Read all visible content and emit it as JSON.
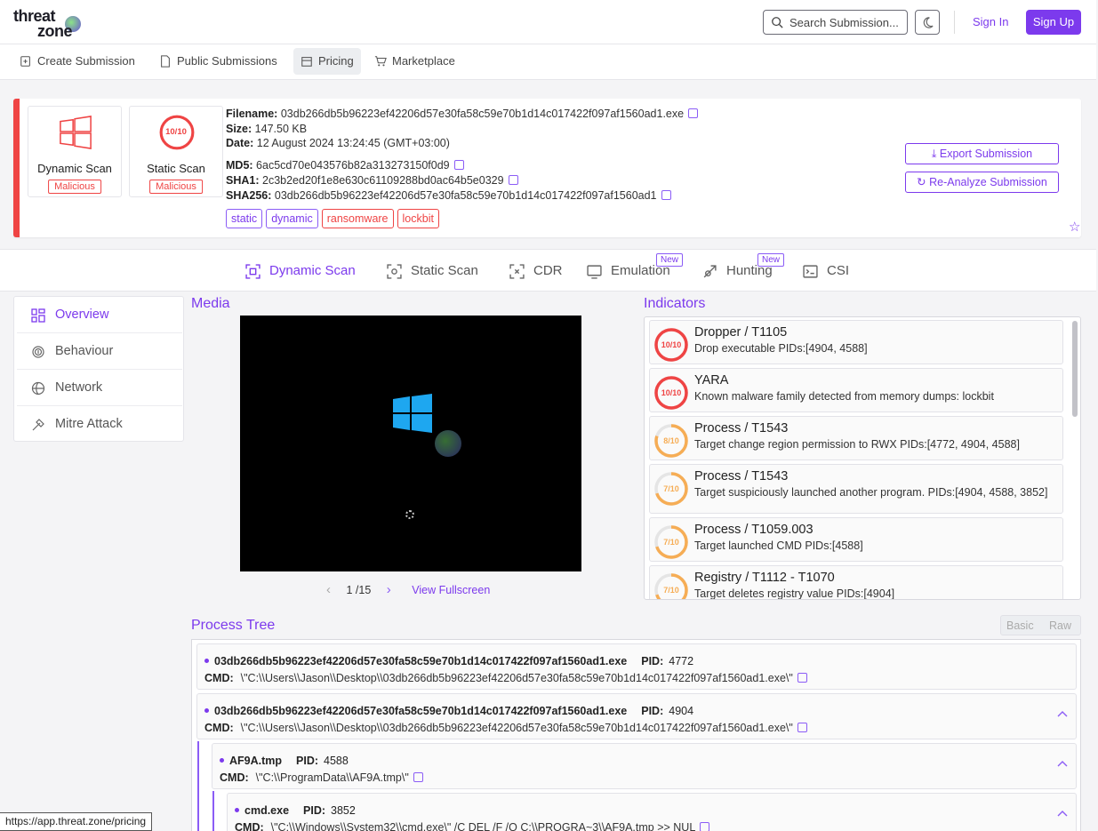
{
  "brand": {
    "line1": "threat",
    "line2": "zone"
  },
  "header": {
    "search_placeholder": "Search Submission...",
    "signin": "Sign In",
    "signup": "Sign Up"
  },
  "nav": [
    {
      "label": "Create Submission"
    },
    {
      "label": "Public Submissions"
    },
    {
      "label": "Pricing"
    },
    {
      "label": "Marketplace"
    }
  ],
  "scans": [
    {
      "title": "Dynamic Scan",
      "verdict": "Malicious"
    },
    {
      "title": "Static Scan",
      "score": "10/10",
      "verdict": "Malicious"
    }
  ],
  "file": {
    "filename_label": "Filename:",
    "filename": "03db266db5b96223ef42206d57e30fa58c59e70b1d14c017422f097af1560ad1.exe",
    "size_label": "Size:",
    "size": "147.50 KB",
    "date_label": "Date:",
    "date": "12 August 2024 13:24:45 (GMT+03:00)",
    "md5_label": "MD5:",
    "md5": "6ac5cd70e043576b82a313273150f0d9",
    "sha1_label": "SHA1:",
    "sha1": "2c3b2ed20f1e8e630c61109288bd0ac64b5e0329",
    "sha256_label": "SHA256:",
    "sha256": "03db266db5b96223ef42206d57e30fa58c59e70b1d14c017422f097af1560ad1"
  },
  "tags": [
    "static",
    "dynamic",
    "ransomware",
    "lockbit"
  ],
  "actions": {
    "export": "Export Submission",
    "reanalyze": "Re-Analyze Submission"
  },
  "tabs": [
    {
      "label": "Dynamic Scan"
    },
    {
      "label": "Static Scan"
    },
    {
      "label": "CDR"
    },
    {
      "label": "Emulation",
      "badge": "New"
    },
    {
      "label": "Hunting",
      "badge": "New"
    },
    {
      "label": "CSI"
    }
  ],
  "sidebar": [
    {
      "label": "Overview"
    },
    {
      "label": "Behaviour"
    },
    {
      "label": "Network"
    },
    {
      "label": "Mitre Attack"
    }
  ],
  "media": {
    "title": "Media",
    "page": "1 /15",
    "fullscreen": "View Fullscreen"
  },
  "indicators_title": "Indicators",
  "indicators": [
    {
      "score": "10/10",
      "level": 1.0,
      "color": "#ef4444",
      "title": "Dropper / T1105",
      "desc": "Drop executable PIDs:[4904, 4588]"
    },
    {
      "score": "10/10",
      "level": 1.0,
      "color": "#ef4444",
      "title": "YARA",
      "desc": "Known malware family detected from memory dumps: lockbit"
    },
    {
      "score": "8/10",
      "level": 0.8,
      "color": "#f6ad55",
      "title": "Process / T1543",
      "desc": "Target change region permission to RWX PIDs:[4772, 4904, 4588]"
    },
    {
      "score": "7/10",
      "level": 0.7,
      "color": "#f6ad55",
      "title": "Process / T1543",
      "desc": "Target suspiciously launched another program. PIDs:[4904, 4588, 3852]"
    },
    {
      "score": "7/10",
      "level": 0.7,
      "color": "#f6ad55",
      "title": "Process / T1059.003",
      "desc": "Target launched CMD PIDs:[4588]"
    },
    {
      "score": "7/10",
      "level": 0.7,
      "color": "#f6ad55",
      "title": "Registry / T1112 - T1070",
      "desc": "Target deletes registry value PIDs:[4904]"
    }
  ],
  "process_tree": {
    "title": "Process Tree",
    "toggle": {
      "basic": "Basic",
      "raw": "Raw"
    },
    "pid_label": "PID:",
    "cmd_label": "CMD:",
    "items": [
      {
        "name": "03db266db5b96223ef42206d57e30fa58c59e70b1d14c017422f097af1560ad1.exe",
        "pid": "4772",
        "cmd": "\\\"C:\\\\Users\\\\Jason\\\\Desktop\\\\03db266db5b96223ef42206d57e30fa58c59e70b1d14c017422f097af1560ad1.exe\\\""
      },
      {
        "name": "03db266db5b96223ef42206d57e30fa58c59e70b1d14c017422f097af1560ad1.exe",
        "pid": "4904",
        "cmd": "\\\"C:\\\\Users\\\\Jason\\\\Desktop\\\\03db266db5b96223ef42206d57e30fa58c59e70b1d14c017422f097af1560ad1.exe\\\""
      },
      {
        "name": "AF9A.tmp",
        "pid": "4588",
        "cmd": "\\\"C:\\\\ProgramData\\\\AF9A.tmp\\\""
      },
      {
        "name": "cmd.exe",
        "pid": "3852",
        "cmd": "\\\"C:\\\\Windows\\\\System32\\\\cmd.exe\\\" /C DEL /F /Q C:\\\\PROGRA~3\\\\AF9A.tmp >> NUL"
      }
    ]
  },
  "status_url": "https://app.threat.zone/pricing"
}
